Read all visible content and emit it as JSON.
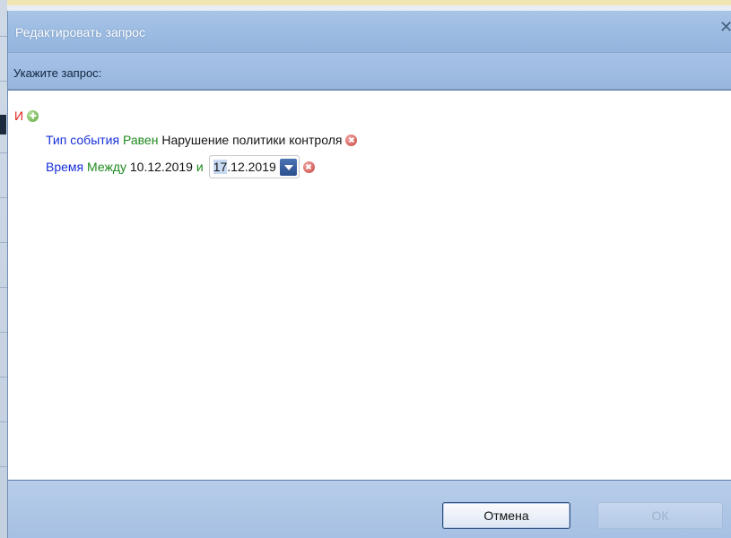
{
  "window": {
    "title": "Редактировать запрос",
    "close_glyph": "✕"
  },
  "prompt": {
    "label": "Укажите запрос:"
  },
  "query": {
    "root_operator": "И",
    "conditions": [
      {
        "field": "Тип события",
        "comparator": "Равен",
        "value": "Нарушение политики контроля"
      },
      {
        "field": "Время",
        "comparator": "Между",
        "value_from": "10.12.2019",
        "joiner": "и",
        "value_to_selected": "17",
        "value_to_rest": ".12.2019"
      }
    ]
  },
  "buttons": {
    "cancel": "Отмена",
    "ok": "ОК"
  },
  "icons": {
    "add": "add-condition-icon",
    "remove": "remove-condition-icon",
    "dropdown": "chevron-down-icon",
    "close": "close-icon"
  },
  "colors": {
    "operator": "#e0201a",
    "field": "#1730d8",
    "comparator": "#1f8a1f",
    "value": "#151515"
  }
}
